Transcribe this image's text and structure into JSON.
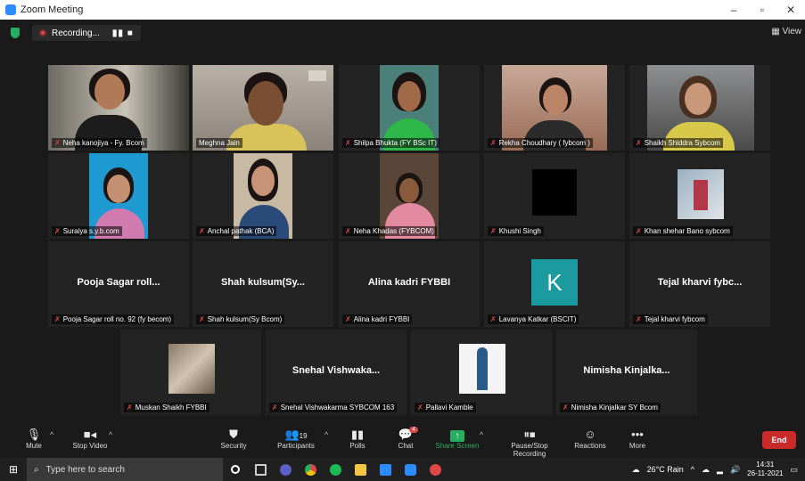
{
  "window": {
    "title": "Zoom Meeting",
    "controls": [
      "–",
      "▫",
      "✕"
    ]
  },
  "topbar": {
    "recording_label": "Recording...",
    "recording_controls": "▮▮ ■",
    "view_label": "View",
    "view_icon": "grid-icon"
  },
  "participants": [
    {
      "name": "Neha kanojiya - Fy. Bcom",
      "video": true
    },
    {
      "name": "Meghna Jain",
      "video": true,
      "active": true
    },
    {
      "name": "Shilpa Bhukta (FY BSc IT)",
      "video": true
    },
    {
      "name": "Rekha Choudhary ( fybcom )",
      "video": true
    },
    {
      "name": "Shaikh Shiddra Sybcom",
      "video": true
    },
    {
      "name": "Suraiya s.y.b.com",
      "video": true
    },
    {
      "name": "Anchal pathak (BCA)",
      "video": true
    },
    {
      "name": "Neha Khadas (FYBCOM)",
      "video": true
    },
    {
      "name": "Khushi Singh",
      "video": false,
      "placeholder": "black"
    },
    {
      "name": "Khan shehar Bano sybcom",
      "video": true
    },
    {
      "name": "Pooja Sagar roll no. 92 (fy becom)",
      "display_name": "Pooja Sagar roll...",
      "video": false
    },
    {
      "name": "Shah kulsum(Sy Bcom)",
      "display_name": "Shah  kulsum(Sy...",
      "video": false
    },
    {
      "name": "Alina kadri FYBBI",
      "display_name": "Alina kadri FYBBI",
      "video": false
    },
    {
      "name": "Lavanya Katkar (BSCIT)",
      "video": false,
      "avatar_letter": "K"
    },
    {
      "name": "Tejal kharvi fybcom",
      "display_name": "Tejal kharvi fybc...",
      "video": false
    },
    {
      "name": "Muskan Shaikh FYBBI",
      "video": true
    },
    {
      "name": "Snehal Vishwakarma SYBCOM 163",
      "display_name": "Snehal  Vishwaka...",
      "video": false
    },
    {
      "name": "Pallavi Kamble",
      "video": true
    },
    {
      "name": "Nimisha Kinjalkar SY Bcom",
      "display_name": "Nimisha  Kinjalka...",
      "video": false
    }
  ],
  "toolbar": {
    "mute": "Mute",
    "stop_video": "Stop Video",
    "security": "Security",
    "participants": "Participants",
    "participant_count": "19",
    "polls": "Polls",
    "chat": "Chat",
    "chat_badge": "4",
    "share_screen": "Share Screen",
    "pause_stop_recording": "Pause/Stop Recording",
    "reactions": "Reactions",
    "more": "More",
    "end": "End"
  },
  "taskbar": {
    "search_placeholder": "Type here to search",
    "weather": "26°C  Rain",
    "time": "14:31",
    "date": "26-11-2021"
  },
  "colors": {
    "active_speaker": "#c8d34a",
    "share_green": "#27ae60",
    "end_red": "#c92a2a",
    "muted_red": "#e04848"
  }
}
